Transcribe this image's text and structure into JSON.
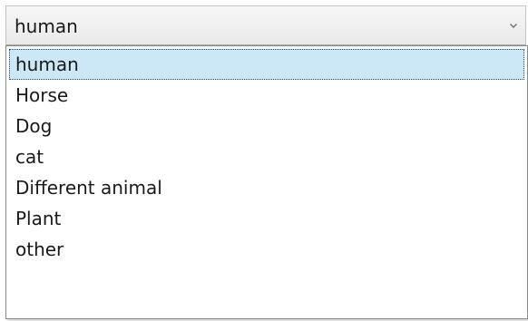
{
  "select": {
    "value": "human",
    "chevron_icon": "chevron-down-icon"
  },
  "dropdown": {
    "selected_index": 0,
    "options": [
      {
        "label": "human"
      },
      {
        "label": "Horse"
      },
      {
        "label": "Dog"
      },
      {
        "label": "cat"
      },
      {
        "label": "Different animal"
      },
      {
        "label": "Plant"
      },
      {
        "label": "other"
      }
    ]
  },
  "colors": {
    "highlight": "#cce8f6",
    "focus_border": "#1e4a7a",
    "text": "#1a1a1a"
  }
}
